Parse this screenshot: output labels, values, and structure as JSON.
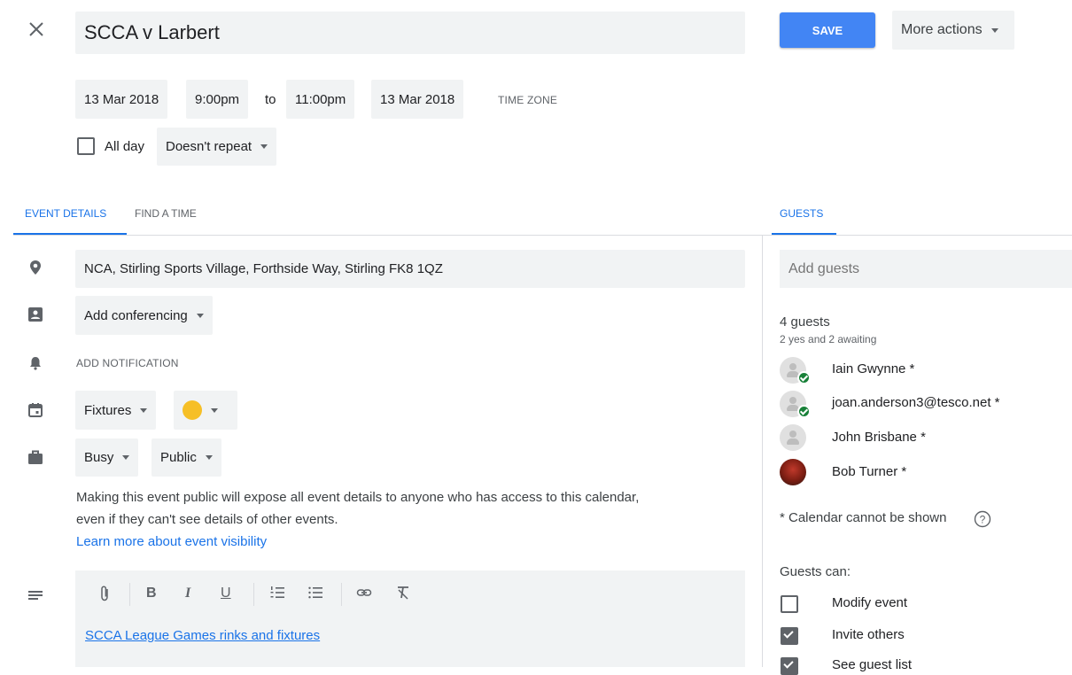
{
  "header": {
    "title": "SCCA v Larbert",
    "save_label": "SAVE",
    "more_actions_label": "More actions"
  },
  "datetime": {
    "start_date": "13 Mar 2018",
    "start_time": "9:00pm",
    "to_label": "to",
    "end_time": "11:00pm",
    "end_date": "13 Mar 2018",
    "time_zone_label": "TIME ZONE",
    "all_day_label": "All day",
    "repeat_label": "Doesn't repeat"
  },
  "tabs": {
    "event_details": "EVENT DETAILS",
    "find_a_time": "FIND A TIME",
    "guests": "GUESTS"
  },
  "details": {
    "location": "NCA, Stirling Sports Village, Forthside Way, Stirling FK8 1QZ",
    "conferencing_label": "Add conferencing",
    "notification_label": "ADD NOTIFICATION",
    "calendar_label": "Fixtures",
    "calendar_color": "#f6bf26",
    "busy_label": "Busy",
    "visibility_label": "Public",
    "visibility_note_line1": "Making this event public will expose all event details to anyone who has access to this calendar,",
    "visibility_note_line2": "even if they can't see details of other events.",
    "visibility_link": "Learn more about event visibility",
    "description_link": "SCCA League Games rinks and fixtures"
  },
  "guests": {
    "add_placeholder": "Add guests",
    "count_label": "4 guests",
    "summary": "2 yes and 2 awaiting",
    "list": [
      {
        "name": "Iain Gwynne *",
        "status": "yes"
      },
      {
        "name": "joan.anderson3@tesco.net *",
        "status": "yes"
      },
      {
        "name": "John Brisbane *",
        "status": "awaiting"
      },
      {
        "name": "Bob Turner *",
        "status": "awaiting"
      }
    ],
    "calendar_note": "* Calendar cannot be shown",
    "permissions_title": "Guests can:",
    "permissions": [
      {
        "label": "Modify event",
        "checked": false
      },
      {
        "label": "Invite others",
        "checked": true
      },
      {
        "label": "See guest list",
        "checked": true
      }
    ]
  },
  "colors": {
    "accent": "#1a73e8",
    "save_button": "#4285f4"
  }
}
